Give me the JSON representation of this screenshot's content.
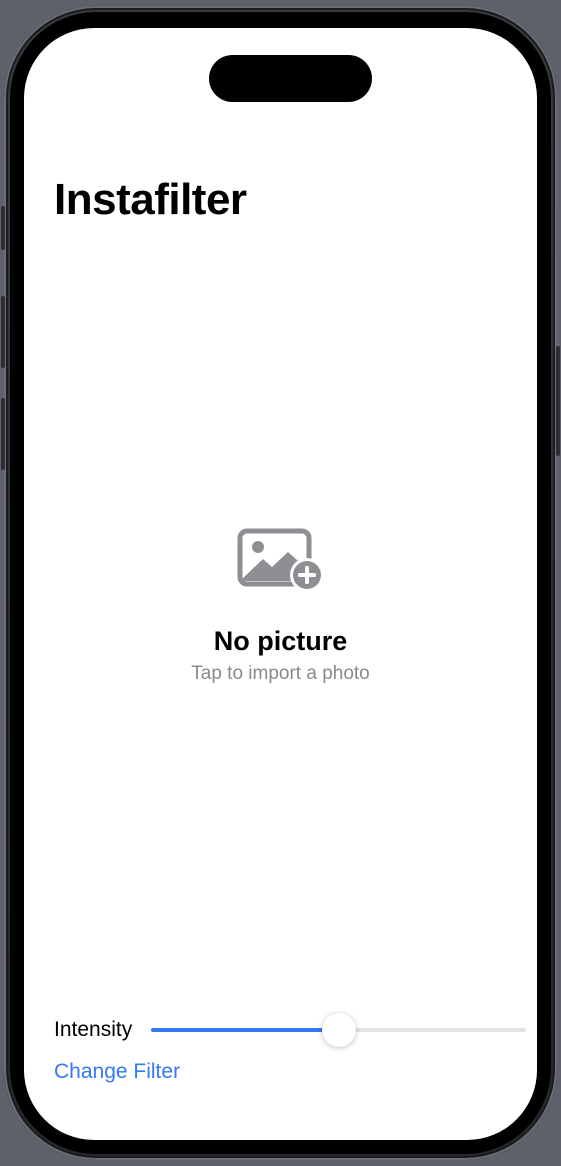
{
  "nav": {
    "title": "Instafilter"
  },
  "placeholder": {
    "icon": "photo-badge-plus-icon",
    "title": "No picture",
    "subtitle": "Tap to import a photo"
  },
  "controls": {
    "intensity_label": "Intensity",
    "intensity_value": 0.5,
    "change_filter_label": "Change Filter"
  },
  "colors": {
    "accent": "#3478f6",
    "icon_gray": "#8e8e93",
    "secondary_text": "#8a8a8e",
    "track": "#e3e3e6"
  }
}
